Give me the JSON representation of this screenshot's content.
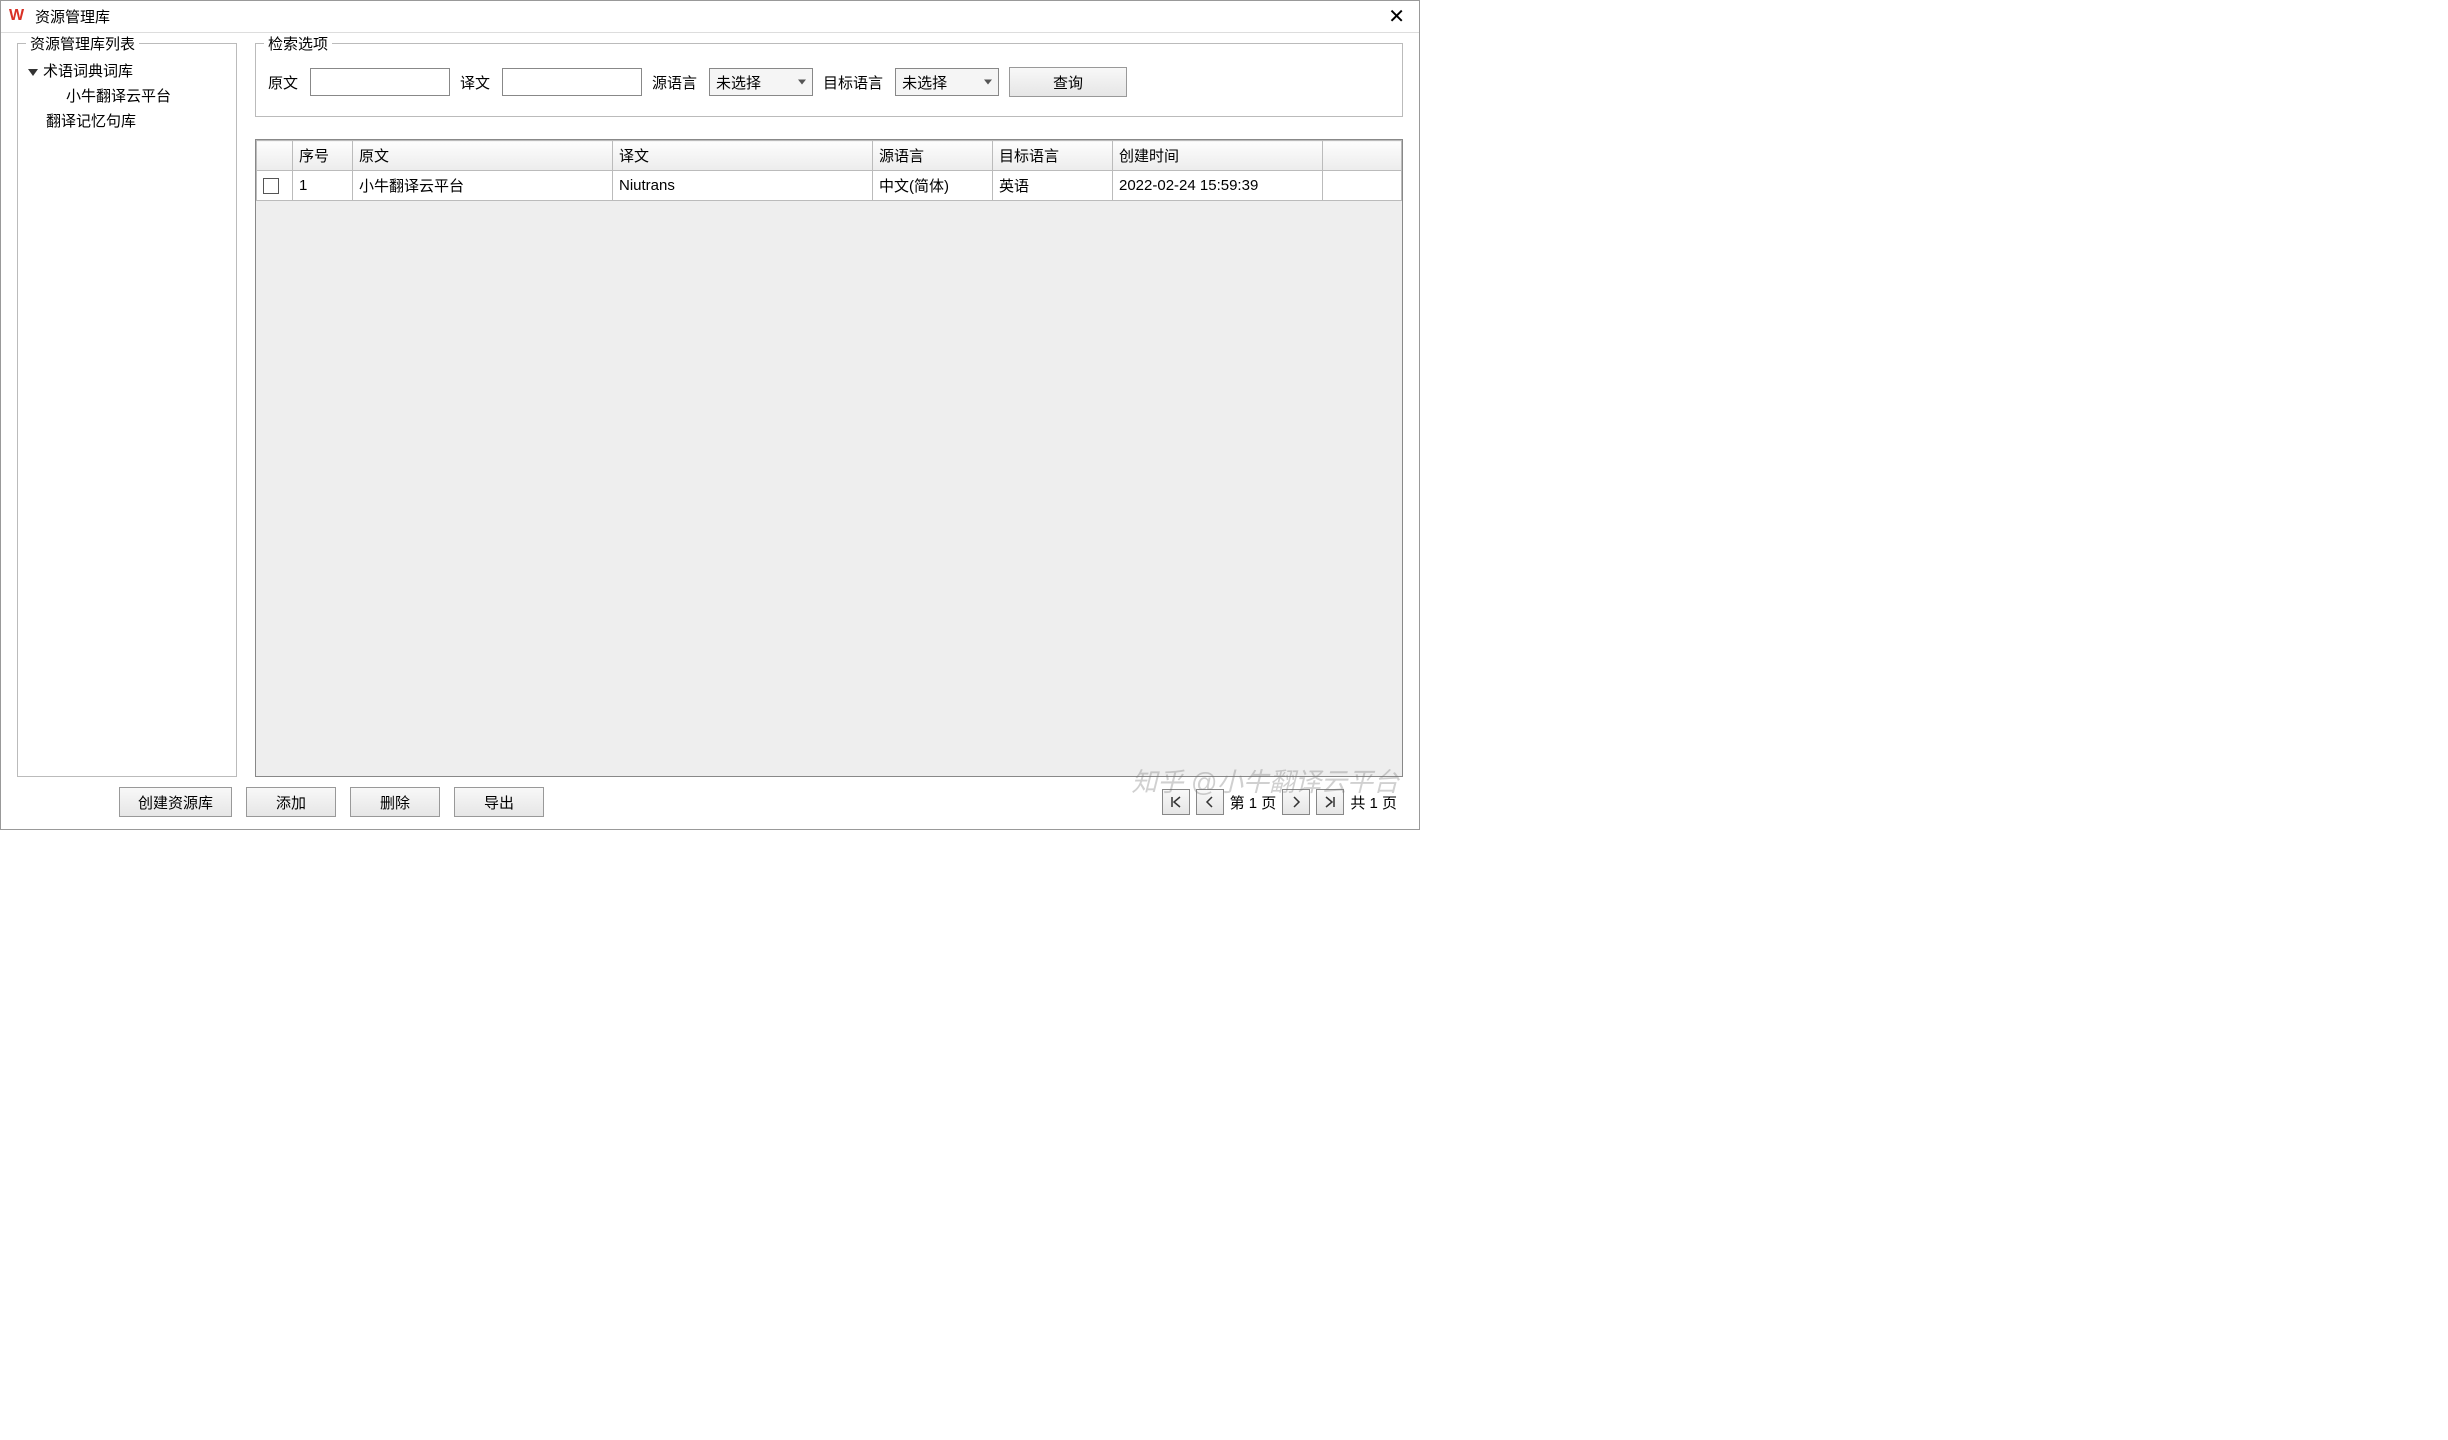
{
  "window": {
    "title": "资源管理库"
  },
  "sidebar": {
    "group_label": "资源管理库列表",
    "items": [
      {
        "label": "术语词典词库",
        "children": [
          {
            "label": "小牛翻译云平台"
          }
        ]
      },
      {
        "label": "翻译记忆句库"
      }
    ]
  },
  "search": {
    "group_label": "检索选项",
    "source_label": "原文",
    "target_label": "译文",
    "source_lang_label": "源语言",
    "target_lang_label": "目标语言",
    "unselected": "未选择",
    "query_button": "查询"
  },
  "table": {
    "headers": {
      "index": "序号",
      "source": "原文",
      "target": "译文",
      "source_lang": "源语言",
      "target_lang": "目标语言",
      "created": "创建时间"
    },
    "rows": [
      {
        "index": "1",
        "source": "小牛翻译云平台",
        "target": "Niutrans",
        "source_lang": "中文(简体)",
        "target_lang": "英语",
        "created": "2022-02-24 15:59:39"
      }
    ]
  },
  "footer": {
    "create_repo": "创建资源库",
    "add": "添加",
    "delete": "删除",
    "export": "导出",
    "page_label": "第 1 页",
    "total_label": "共 1 页"
  },
  "watermark": "知乎 @小牛翻译云平台"
}
